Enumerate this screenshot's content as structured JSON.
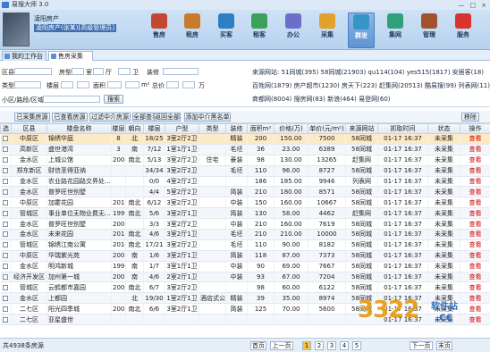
{
  "window": {
    "title": "易搜大师 3.0",
    "minimize": "—",
    "maximize": "□",
    "close": "×"
  },
  "user": {
    "name": "凌阳房产",
    "company": "凌阳房产(张某)[高级管理员]"
  },
  "nav": [
    {
      "label": "售房",
      "icon": "house-icon",
      "color": "#c4482f"
    },
    {
      "label": "租房",
      "icon": "key-house-icon",
      "color": "#c97a2b"
    },
    {
      "label": "买客",
      "icon": "buyer-icon",
      "color": "#2f7ec4"
    },
    {
      "label": "租客",
      "icon": "tenant-icon",
      "color": "#3aa05a"
    },
    {
      "label": "办公",
      "icon": "office-icon",
      "color": "#6b6fc9"
    },
    {
      "label": "采集",
      "icon": "collect-icon",
      "color": "#e2a12a"
    },
    {
      "label": "群发",
      "icon": "broadcast-icon",
      "color": "#3596c9"
    },
    {
      "label": "集网",
      "icon": "network-icon",
      "color": "#2fa07a"
    },
    {
      "label": "管理",
      "icon": "manage-icon",
      "color": "#a0522d"
    },
    {
      "label": "服务",
      "icon": "service-icon",
      "color": "#d9342b"
    }
  ],
  "tabs": [
    {
      "label": "我的工作台"
    },
    {
      "label": "售房采集"
    }
  ],
  "filter": {
    "district": "区县",
    "price_sep": "房型",
    "room": "室",
    "hall": "厅",
    "toilet": "卫",
    "deco": "装修",
    "type": "类型",
    "floor": "楼层",
    "area": "面积",
    "area_unit": "m²",
    "total": "总价",
    "price_unit": "万",
    "road": "小区/路段/区域",
    "search": "搜索"
  },
  "sources": {
    "line1": "来源网站: 51同城(395) 58同城(21903) qu114(104) yes515(1817) 安居客(18)",
    "line2": "百姓网(1879) 房产超市(1230) 房天下(223) 赶集网(20513) 酷易搜(99) 列表网(11)",
    "line3": "商都网(8004) 搜房网(83) 新浪(464) 易登网(60)"
  },
  "toolbar": {
    "b1": "已采集房源",
    "b2": "已查看房源",
    "b3": "过滤中介房源",
    "b4": "全部查看",
    "b5": "返回全部",
    "b6": "添加中介黑名单",
    "remove": "移除"
  },
  "table": {
    "headers": [
      "选",
      "区县",
      "楼盘名称",
      "楼层",
      "朝向",
      "楼层",
      "户型",
      "类型",
      "装修",
      "面积m²",
      "价格(万)",
      "单价(元/m²)",
      "来源网站",
      "抓取时间",
      "状态",
      "操作"
    ],
    "rows": [
      [
        "中原区",
        "锦绣华庭",
        "8",
        "北",
        "18/25",
        "3室2厅2卫",
        "",
        "精装",
        "200",
        "150.00",
        "7500",
        "58同城",
        "01-17 16:37",
        "未采集",
        "查看"
      ],
      [
        "高新区",
        "盛世港湾",
        "3",
        "南",
        "7/12",
        "1室1厅1卫",
        "",
        "毛坯",
        "36",
        "23.00",
        "6389",
        "58同城",
        "01-17 16:37",
        "未采集",
        "查看"
      ],
      [
        "金水区",
        "上城公馆",
        "2008",
        "南北",
        "5/13",
        "3室2厅2卫",
        "住宅",
        "豪装",
        "98",
        "130.00",
        "13265",
        "赶集网",
        "01-17 16:37",
        "未采集",
        "查看"
      ],
      [
        "郑东新区",
        "财信圣得亚纳",
        "",
        "",
        "34/34",
        "3室2厅2卫",
        "",
        "毛坯",
        "110",
        "96.00",
        "8727",
        "58同城",
        "01-17 16:37",
        "未采集",
        "查看"
      ],
      [
        "金水区",
        "农业路花园路交界处...",
        "",
        "",
        "0/0",
        "4室2厅2卫",
        "",
        "",
        "186",
        "185.00",
        "9946",
        "列表网",
        "01-17 16:37",
        "未采集",
        "查看"
      ],
      [
        "金水区",
        "普罗旺世别墅",
        "",
        "",
        "4/4",
        "5室2厅2卫",
        "",
        "简装",
        "210",
        "180.00",
        "8571",
        "58同城",
        "01-17 16:37",
        "未采集",
        "查看"
      ],
      [
        "中原区",
        "加霍花园",
        "2012",
        "南北",
        "6/12",
        "3室2厅2卫",
        "",
        "中装",
        "150",
        "160.00",
        "10667",
        "58同城",
        "01-17 16:37",
        "未采集",
        "查看"
      ],
      [
        "管城区",
        "事业单位无物业费无...",
        "1999",
        "南北",
        "5/6",
        "3室2厅1卫",
        "",
        "简装",
        "130",
        "58.00",
        "4462",
        "赶集网",
        "01-17 16:37",
        "未采集",
        "查看"
      ],
      [
        "金水区",
        "普罗旺世别墅",
        "2006",
        "",
        "3/3",
        "3室2厅2卫",
        "",
        "中装",
        "210",
        "160.00",
        "7619",
        "58同城",
        "01-17 16:37",
        "未采集",
        "查看"
      ],
      [
        "金水区",
        "未来花园",
        "2012",
        "南北",
        "4/6",
        "3室2厅1卫",
        "",
        "毛坯",
        "210",
        "210.00",
        "10000",
        "58同城",
        "01-17 16:37",
        "未采集",
        "查看"
      ],
      [
        "管城区",
        "锦绣江南公寓",
        "2010",
        "南北",
        "17/21",
        "3室2厅2卫",
        "",
        "毛坯",
        "110",
        "90.00",
        "8182",
        "58同城",
        "01-17 16:37",
        "未采集",
        "查看"
      ],
      [
        "中原区",
        "华瑞紫光苑",
        "2005",
        "南",
        "1/6",
        "3室2厅1卫",
        "",
        "简装",
        "118",
        "87.00",
        "7373",
        "58同城",
        "01-17 16:37",
        "未采集",
        "查看"
      ],
      [
        "金水区",
        "明鸿新城",
        "1996",
        "南",
        "1/7",
        "3室1厅1卫",
        "",
        "中装",
        "90",
        "69.00",
        "7667",
        "58同城",
        "01-17 16:37",
        "未采集",
        "查看"
      ],
      [
        "经济开发区",
        "加州第一城",
        "2007",
        "南",
        "4/6",
        "2室2厅1卫",
        "",
        "中装",
        "93",
        "67.00",
        "7204",
        "58同城",
        "01-17 16:37",
        "未采集",
        "查看"
      ],
      [
        "管城区",
        "云鹤都市嘉园",
        "2006",
        "南北",
        "6/7",
        "3室2厅2卫",
        "",
        "",
        "98",
        "60.00",
        "6122",
        "58同城",
        "01-17 16:37",
        "未采集",
        "查看"
      ],
      [
        "金水区",
        "上都园",
        "",
        "北",
        "19/30",
        "1室2厅1卫",
        "酒店式公...",
        "精装",
        "39",
        "35.00",
        "8974",
        "58同城",
        "01-17 16:37",
        "未采集",
        "查看"
      ],
      [
        "二七区",
        "阳光四季城",
        "2003",
        "南北",
        "6/6",
        "3室2厅1卫",
        "",
        "简装",
        "125",
        "70.00",
        "5600",
        "58同城",
        "01-17 16:37",
        "未采集",
        "查看"
      ],
      [
        "二七区",
        "亚星盛世",
        "",
        "",
        "",
        "",
        "",
        "",
        "",
        "",
        "",
        "",
        "01-17 16:37",
        "未采集",
        "查看"
      ]
    ]
  },
  "status": {
    "total": "共4938条房源"
  },
  "pager": {
    "first": "首页",
    "prev": "上一页",
    "p1": "1",
    "p2": "2",
    "p3": "3",
    "p4": "4",
    "p5": "5",
    "next": "下一页",
    "last": "末页"
  },
  "watermark": {
    "big": "3322",
    "small": "软件站",
    "cc": ".cc"
  }
}
